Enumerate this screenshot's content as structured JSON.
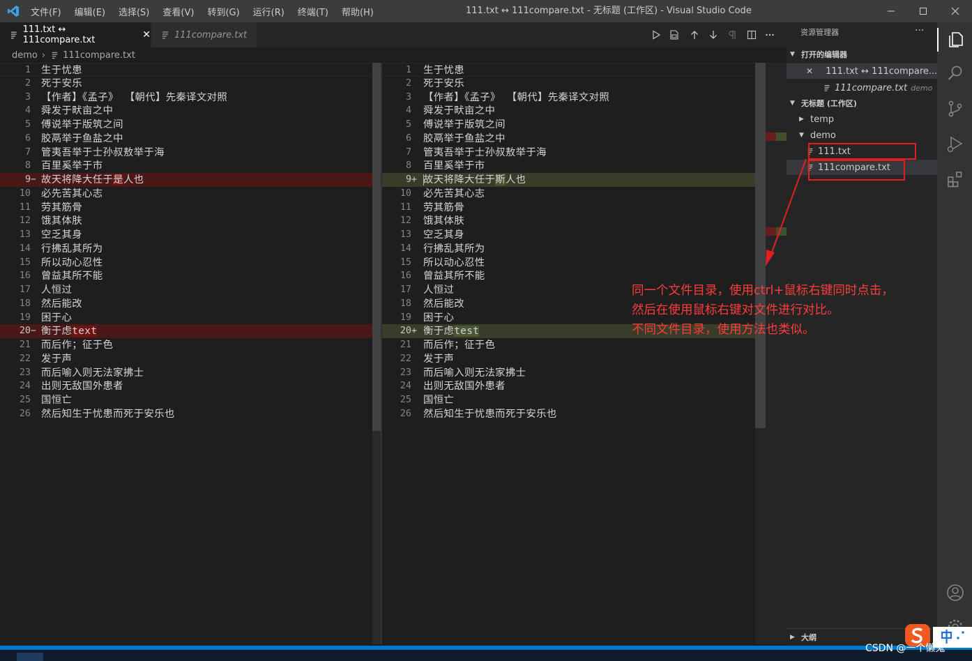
{
  "titlebar": {
    "menus": [
      "文件(F)",
      "编辑(E)",
      "选择(S)",
      "查看(V)",
      "转到(G)",
      "运行(R)",
      "终端(T)",
      "帮助(H)"
    ],
    "window_title": "111.txt ↔ 111compare.txt - 无标题 (工作区) - Visual Studio Code"
  },
  "tabs": [
    {
      "label": "111.txt ↔ 111compare.txt",
      "active": true,
      "close": "✕"
    },
    {
      "label": "111compare.txt",
      "active": false
    }
  ],
  "breadcrumb": {
    "folder": "demo",
    "separator": "›",
    "file": "111compare.txt"
  },
  "diff": {
    "left_lines": [
      {
        "n": "1",
        "text": "生于忧患"
      },
      {
        "n": "2",
        "text": "死于安乐"
      },
      {
        "n": "3",
        "text": "【作者】《孟子》 【朝代】先秦译文对照"
      },
      {
        "n": "4",
        "text": "舜发于畎亩之中"
      },
      {
        "n": "5",
        "text": "傅说举于版筑之间"
      },
      {
        "n": "6",
        "text": "胶鬲举于鱼盐之中"
      },
      {
        "n": "7",
        "text": "管夷吾举于士孙叔敖举于海"
      },
      {
        "n": "8",
        "text": "百里奚举于市"
      },
      {
        "n": "9",
        "text": "故天将降大任于是人也",
        "marker": "−",
        "changed": "是"
      },
      {
        "n": "10",
        "text": "必先苦其心志"
      },
      {
        "n": "11",
        "text": "劳其筋骨"
      },
      {
        "n": "12",
        "text": "饿其体肤"
      },
      {
        "n": "13",
        "text": "空乏其身"
      },
      {
        "n": "14",
        "text": "行拂乱其所为"
      },
      {
        "n": "15",
        "text": "所以动心忍性"
      },
      {
        "n": "16",
        "text": "曾益其所不能"
      },
      {
        "n": "17",
        "text": "人恒过"
      },
      {
        "n": "18",
        "text": "然后能改"
      },
      {
        "n": "19",
        "text": "困于心"
      },
      {
        "n": "20",
        "text": "衡于虑text",
        "marker": "−",
        "changed": "text"
      },
      {
        "n": "21",
        "text": "而后作；征于色"
      },
      {
        "n": "22",
        "text": "发于声"
      },
      {
        "n": "23",
        "text": "而后喻入则无法家拂士"
      },
      {
        "n": "24",
        "text": "出则无敌国外患者"
      },
      {
        "n": "25",
        "text": "国恒亡"
      },
      {
        "n": "26",
        "text": "然后知生于忧患而死于安乐也"
      }
    ],
    "right_lines": [
      {
        "n": "1",
        "text": "生于忧患"
      },
      {
        "n": "2",
        "text": "死于安乐"
      },
      {
        "n": "3",
        "text": "【作者】《孟子》 【朝代】先秦译文对照"
      },
      {
        "n": "4",
        "text": "舜发于畎亩之中"
      },
      {
        "n": "5",
        "text": "傅说举于版筑之间"
      },
      {
        "n": "6",
        "text": "胶鬲举于鱼盐之中"
      },
      {
        "n": "7",
        "text": "管夷吾举于士孙叔敖举于海"
      },
      {
        "n": "8",
        "text": "百里奚举于市"
      },
      {
        "n": "9",
        "text": "故天将降大任于斯人也",
        "marker": "+",
        "changed": "斯"
      },
      {
        "n": "10",
        "text": "必先苦其心志"
      },
      {
        "n": "11",
        "text": "劳其筋骨"
      },
      {
        "n": "12",
        "text": "饿其体肤"
      },
      {
        "n": "13",
        "text": "空乏其身"
      },
      {
        "n": "14",
        "text": "行拂乱其所为"
      },
      {
        "n": "15",
        "text": "所以动心忍性"
      },
      {
        "n": "16",
        "text": "曾益其所不能"
      },
      {
        "n": "17",
        "text": "人恒过"
      },
      {
        "n": "18",
        "text": "然后能改"
      },
      {
        "n": "19",
        "text": "困于心"
      },
      {
        "n": "20",
        "text": "衡于虑test",
        "marker": "+",
        "changed": "test"
      },
      {
        "n": "21",
        "text": "而后作；征于色"
      },
      {
        "n": "22",
        "text": "发于声"
      },
      {
        "n": "23",
        "text": "而后喻入则无法家拂士"
      },
      {
        "n": "24",
        "text": "出则无敌国外患者"
      },
      {
        "n": "25",
        "text": "国恒亡"
      },
      {
        "n": "26",
        "text": "然后知生于忧患而死于安乐也"
      }
    ]
  },
  "explorer": {
    "title": "资源管理器",
    "more": "···",
    "open_editors_label": "打开的编辑器",
    "open_editors": [
      {
        "label": "111.txt ↔ 111compare....",
        "close": "✕"
      },
      {
        "label": "111compare.txt",
        "desc": "demo"
      }
    ],
    "workspace_label": "无标题 (工作区)",
    "tree": [
      {
        "label": "temp",
        "type": "folder",
        "expanded": false
      },
      {
        "label": "demo",
        "type": "folder",
        "expanded": true
      },
      {
        "label": "111.txt",
        "type": "file"
      },
      {
        "label": "111compare.txt",
        "type": "file",
        "selected": true
      }
    ],
    "outline_label": "大纲"
  },
  "annotation": {
    "lines": [
      "同一个文件目录，使用ctrl+鼠标右键同时点击，",
      "然后在使用鼠标右键对文件进行对比。",
      "不同文件目录，使用方法也类似。"
    ],
    "color": "#ff3c3c"
  },
  "watermark": "CSDN @一个懒鬼",
  "colors": {
    "removed_line": "#4b1818",
    "inserted_line": "#373d29",
    "statusbar": "#007acc",
    "titlebar": "#3c3c3c",
    "sidebar": "#252526"
  }
}
